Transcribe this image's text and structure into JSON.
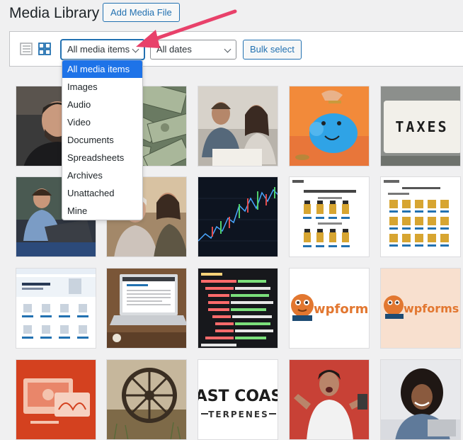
{
  "header": {
    "title": "Media Library",
    "add_button": "Add Media File"
  },
  "toolbar": {
    "media_filter": "All media items",
    "date_filter": "All dates",
    "bulk_select": "Bulk select"
  },
  "dropdown": {
    "options": [
      "All media items",
      "Images",
      "Audio",
      "Video",
      "Documents",
      "Spreadsheets",
      "Archives",
      "Unattached",
      "Mine"
    ],
    "selected": "All media items"
  },
  "tiles": {
    "taxes_text": "TAXES",
    "wpforms_1": "wpform",
    "wpforms_2": "wpforms",
    "east_coast": "AST COAS",
    "terpenes": "TERPENES"
  },
  "colors": {
    "accent": "#2271b1",
    "dropdown_highlight": "#1e73e8",
    "arrow": "#e8416a"
  }
}
